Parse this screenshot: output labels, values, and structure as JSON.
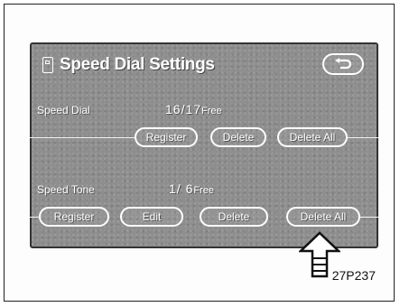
{
  "screen": {
    "title": "Speed Dial Settings",
    "back_icon": "return-arrow-icon"
  },
  "speed_dial": {
    "label": "Speed Dial",
    "count": "16/17",
    "free_suffix": "Free",
    "buttons": [
      "Register",
      "Delete",
      "Delete All"
    ]
  },
  "speed_tone": {
    "label": "Speed Tone",
    "count": "1/ 6",
    "free_suffix": "Free",
    "buttons": [
      "Register",
      "Edit",
      "Delete",
      "Delete All"
    ]
  },
  "callout": {
    "icon": "pointer-arrow-icon",
    "target": "Delete All"
  },
  "figure_ref": "27P237"
}
